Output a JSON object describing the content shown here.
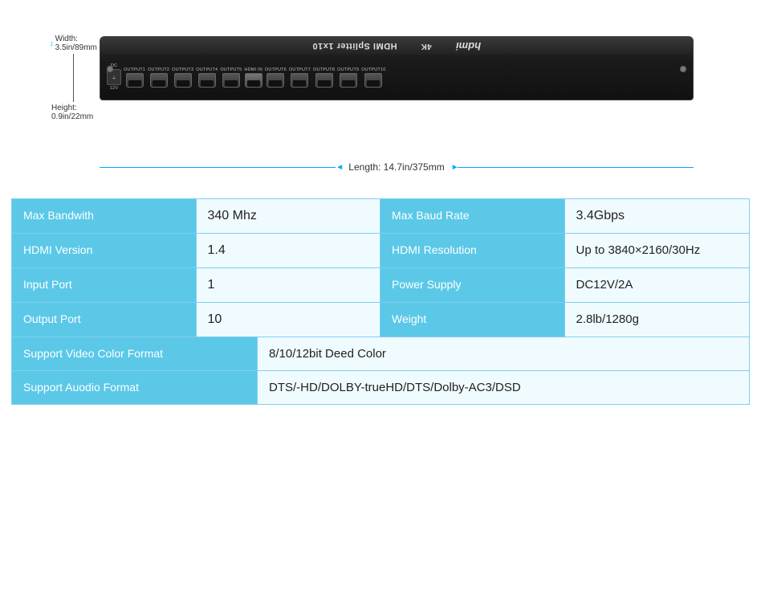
{
  "product": {
    "title_flipped": "HDMI Splitter 1x10",
    "subtitle_flipped": "4K",
    "hdmi_logo": "hdmi",
    "ports": [
      {
        "label": "DC\n12V",
        "type": "dc"
      },
      {
        "label": "OUTPUT1",
        "type": "hdmi"
      },
      {
        "label": "OUTPUT2",
        "type": "hdmi"
      },
      {
        "label": "OUTPUT3",
        "type": "hdmi"
      },
      {
        "label": "OUTPUT4",
        "type": "hdmi"
      },
      {
        "label": "OUTPUT5",
        "type": "hdmi"
      },
      {
        "label": "HDMI IN",
        "type": "hdmi"
      },
      {
        "label": "OUTPUT6",
        "type": "hdmi"
      },
      {
        "label": "OUTPUT7",
        "type": "hdmi"
      },
      {
        "label": "OUTPUT8",
        "type": "hdmi"
      },
      {
        "label": "OUTPUT9",
        "type": "hdmi"
      },
      {
        "label": "OUTPUT10",
        "type": "hdmi"
      }
    ]
  },
  "dimensions": {
    "width": "Width: 3.5in/89mm",
    "height": "Height: 0.9in/22mm",
    "length": "Length: 14.7in/375mm"
  },
  "specs": {
    "rows": [
      {
        "type": "half",
        "left_header": "Max Bandwith",
        "left_value": "340 Mhz",
        "right_header": "Max Baud Rate",
        "right_value": "3.4Gbps"
      },
      {
        "type": "half",
        "left_header": "HDMI Version",
        "left_value": "1.4",
        "right_header": "HDMI Resolution",
        "right_value": "Up to 3840×2160/30Hz"
      },
      {
        "type": "half",
        "left_header": "Input Port",
        "left_value": "1",
        "right_header": "Power Supply",
        "right_value": "DC12V/2A"
      },
      {
        "type": "half",
        "left_header": "Output Port",
        "left_value": "10",
        "right_header": "Weight",
        "right_value": "2.8lb/1280g"
      },
      {
        "type": "full",
        "header": "Support Video Color Format",
        "value": "8/10/12bit Deed Color"
      },
      {
        "type": "full",
        "header": "Support  Auodio  Format",
        "value": "DTS/-HD/DOLBY-trueHD/DTS/Dolby-AC3/DSD"
      }
    ]
  }
}
